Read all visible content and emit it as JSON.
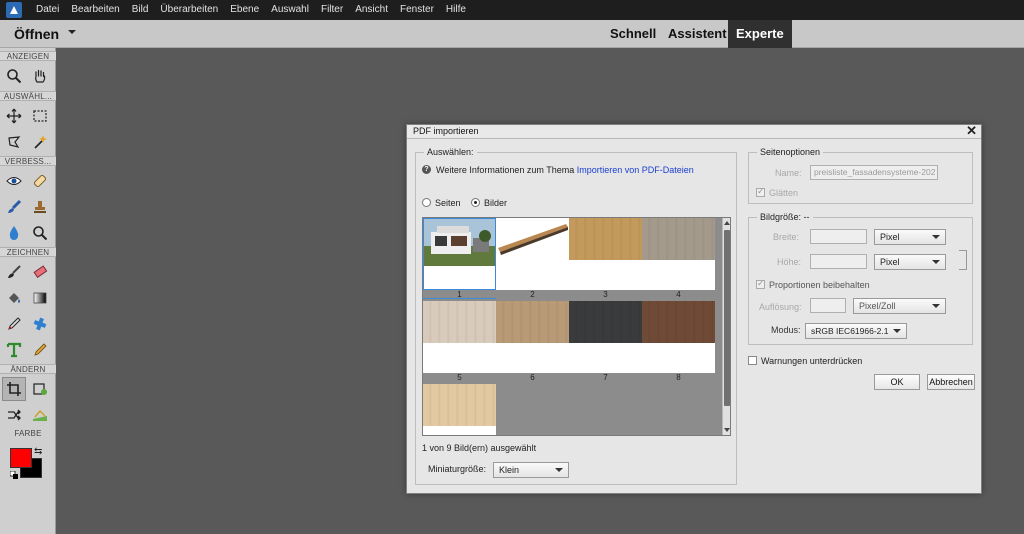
{
  "menubar": {
    "items": [
      "Datei",
      "Bearbeiten",
      "Bild",
      "Überarbeiten",
      "Ebene",
      "Auswahl",
      "Filter",
      "Ansicht",
      "Fenster",
      "Hilfe"
    ]
  },
  "modebar": {
    "open_label": "Öffnen",
    "tabs": [
      {
        "label": "Schnell",
        "active": false
      },
      {
        "label": "Assistent",
        "active": false
      },
      {
        "label": "Experte",
        "active": true
      }
    ]
  },
  "toolbox": {
    "sections": {
      "view": "ANZEIGEN",
      "select": "AUSWÄHL...",
      "enhance": "VERBESS...",
      "draw": "ZEICHNEN",
      "modify": "ÄNDERN",
      "color": "FARBE"
    },
    "icons": {
      "zoom": "zoom-icon",
      "hand": "hand-icon",
      "move": "move-icon",
      "marquee": "rectangle-marquee-icon",
      "lasso": "lasso-icon",
      "magic_wand": "magic-wand-icon",
      "red_eye": "red-eye-icon",
      "spot_heal": "spot-healing-brush-icon",
      "smart_brush": "smart-brush-icon",
      "clone_stamp": "clone-stamp-icon",
      "blur": "blur-icon",
      "sponge": "sponge-icon",
      "brush": "brush-icon",
      "eraser": "eraser-icon",
      "paint_bucket": "paint-bucket-icon",
      "gradient": "gradient-icon",
      "eyedropper": "eyedropper-icon",
      "custom_shape": "custom-shape-icon",
      "type": "type-icon",
      "pencil": "pencil-icon",
      "crop": "crop-icon",
      "recompose": "recompose-icon",
      "content_move": "content-aware-move-icon",
      "straighten": "straighten-icon"
    },
    "foreground_color": "#ff0000",
    "background_color": "#000000"
  },
  "dialog": {
    "title": "PDF importieren",
    "select_group_label": "Auswählen:",
    "info_prefix": "Weitere Informationen zum Thema",
    "info_link": "Importieren von PDF-Dateien",
    "radio_pages": "Seiten",
    "radio_images": "Bilder",
    "selected_radio": "Bilder",
    "thumbnails": [
      {
        "number": "1",
        "selected": true,
        "kind": "house"
      },
      {
        "number": "2",
        "selected": false,
        "kind": "board"
      },
      {
        "number": "3",
        "selected": false,
        "kind": "wood",
        "color": "#c49a5c"
      },
      {
        "number": "4",
        "selected": false,
        "kind": "wood",
        "color": "#a49a8c"
      },
      {
        "number": "5",
        "selected": false,
        "kind": "wood",
        "color": "#d8cbbb"
      },
      {
        "number": "6",
        "selected": false,
        "kind": "wood",
        "color": "#b89a77"
      },
      {
        "number": "7",
        "selected": false,
        "kind": "wood",
        "color": "#3a3b3c"
      },
      {
        "number": "8",
        "selected": false,
        "kind": "wood",
        "color": "#6f4a36"
      },
      {
        "number": "",
        "selected": false,
        "kind": "wood",
        "color": "#e3c9a2"
      }
    ],
    "selection_status": "1 von 9 Bild(ern) ausgewählt",
    "thumb_size_label": "Miniaturgröße:",
    "thumb_size_value": "Klein",
    "page_options_label": "Seitenoptionen",
    "name_label": "Name:",
    "name_value": "preisliste_fassadensysteme-202",
    "smooth_label": "Glätten",
    "smooth_checked": true,
    "image_size_label": "Bildgröße: --",
    "width_label": "Breite:",
    "width_value": "",
    "width_unit": "Pixel",
    "height_label": "Höhe:",
    "height_value": "",
    "height_unit": "Pixel",
    "constrain_label": "Proportionen beibehalten",
    "constrain_checked": true,
    "resolution_label": "Auflösung:",
    "resolution_value": "",
    "resolution_unit": "Pixel/Zoll",
    "mode_label": "Modus:",
    "mode_value": "sRGB IEC61966-2.1",
    "suppress_warnings_label": "Warnungen unterdrücken",
    "suppress_warnings_checked": false,
    "ok_label": "OK",
    "cancel_label": "Abbrechen"
  }
}
